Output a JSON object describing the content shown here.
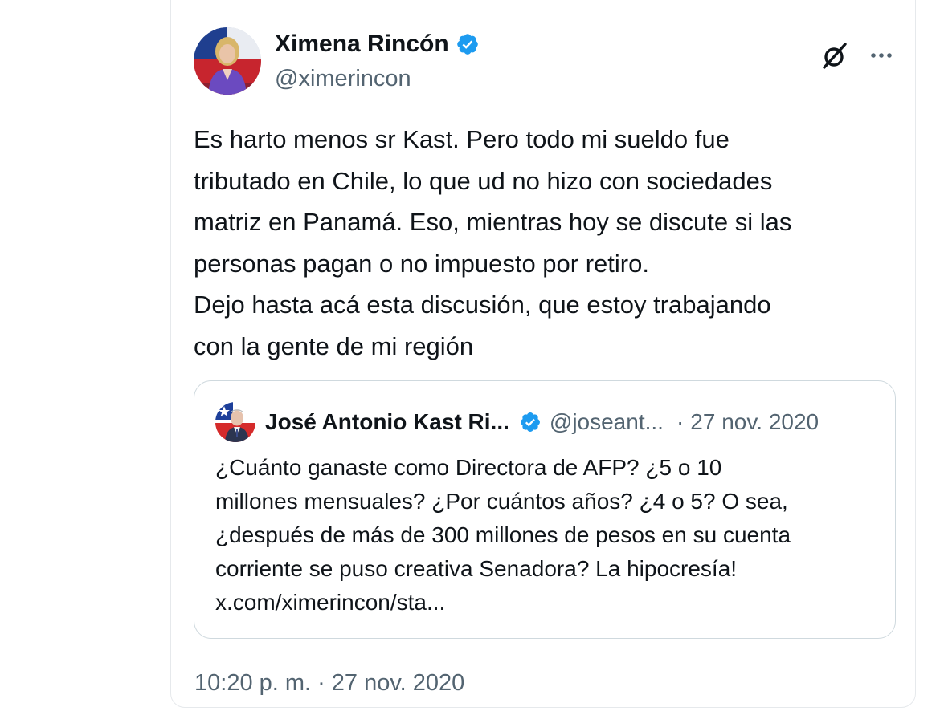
{
  "tweet": {
    "author": {
      "name": "Ximena Rincón",
      "handle": "@ximerincon",
      "avatar_icon": "profile-photo-woman-flag-background",
      "verified": true
    },
    "text_lines": [
      "Es harto menos sr Kast. Pero todo mi  sueldo fue",
      "tributado en Chile, lo que ud no hizo con sociedades",
      "matriz en Panamá. Eso, mientras hoy se discute si las",
      "personas pagan o no impuesto por retiro.",
      "Dejo hasta acá esta discusión, que estoy trabajando",
      "con la gente de mi región"
    ],
    "time": "10:20 p. m.",
    "separator": "·",
    "date": "27 nov. 2020",
    "actions": {
      "grok_icon": "grok-slash-circle-icon",
      "more_icon": "more-dots-icon"
    }
  },
  "quoted_tweet": {
    "author": {
      "name": "José Antonio Kast Ri...",
      "handle": "@joseant...",
      "avatar_icon": "profile-photo-man-chile-flag",
      "verified": true
    },
    "separator": "·",
    "date": "27 nov. 2020",
    "text_lines": [
      "¿Cuánto ganaste como Directora de AFP? ¿5 o 10",
      "millones mensuales? ¿Por cuántos años? ¿4 o 5? O sea,",
      "¿después de más de 300 millones de pesos en su cuenta",
      "corriente se puso creativa Senadora? La hipocresía!",
      "x.com/ximerincon/sta..."
    ]
  },
  "colors": {
    "verified_blue": "#1d9bf0",
    "secondary_text": "#536471",
    "primary_text": "#0f1419",
    "border": "#cfd9de"
  }
}
